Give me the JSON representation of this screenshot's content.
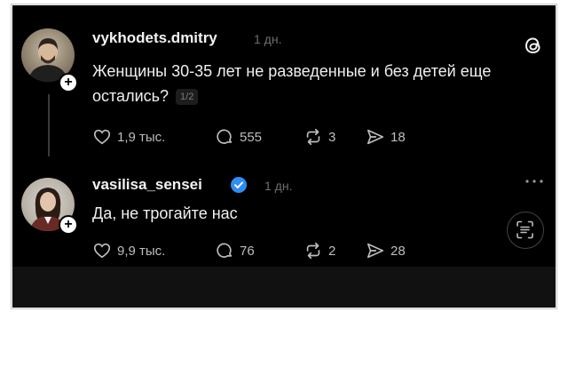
{
  "posts": [
    {
      "username": "vykhodets.dmitry",
      "time": "1 дн.",
      "text": "Женщины 30-35 лет не разведенные и без детей еще остались?",
      "page_counter": "1/2",
      "likes": "1,9 тыс.",
      "replies": "555",
      "reposts": "3",
      "shares": "18"
    },
    {
      "username": "vasilisa_sensei",
      "time": "1 дн.",
      "text": "Да, не трогайте нас",
      "likes": "9,9 тыс.",
      "replies": "76",
      "reposts": "2",
      "shares": "28"
    }
  ],
  "colors": {
    "background": "#000000",
    "text": "#f0f0f0",
    "muted": "#6f6f6f",
    "verified": "#2f8cf4"
  }
}
